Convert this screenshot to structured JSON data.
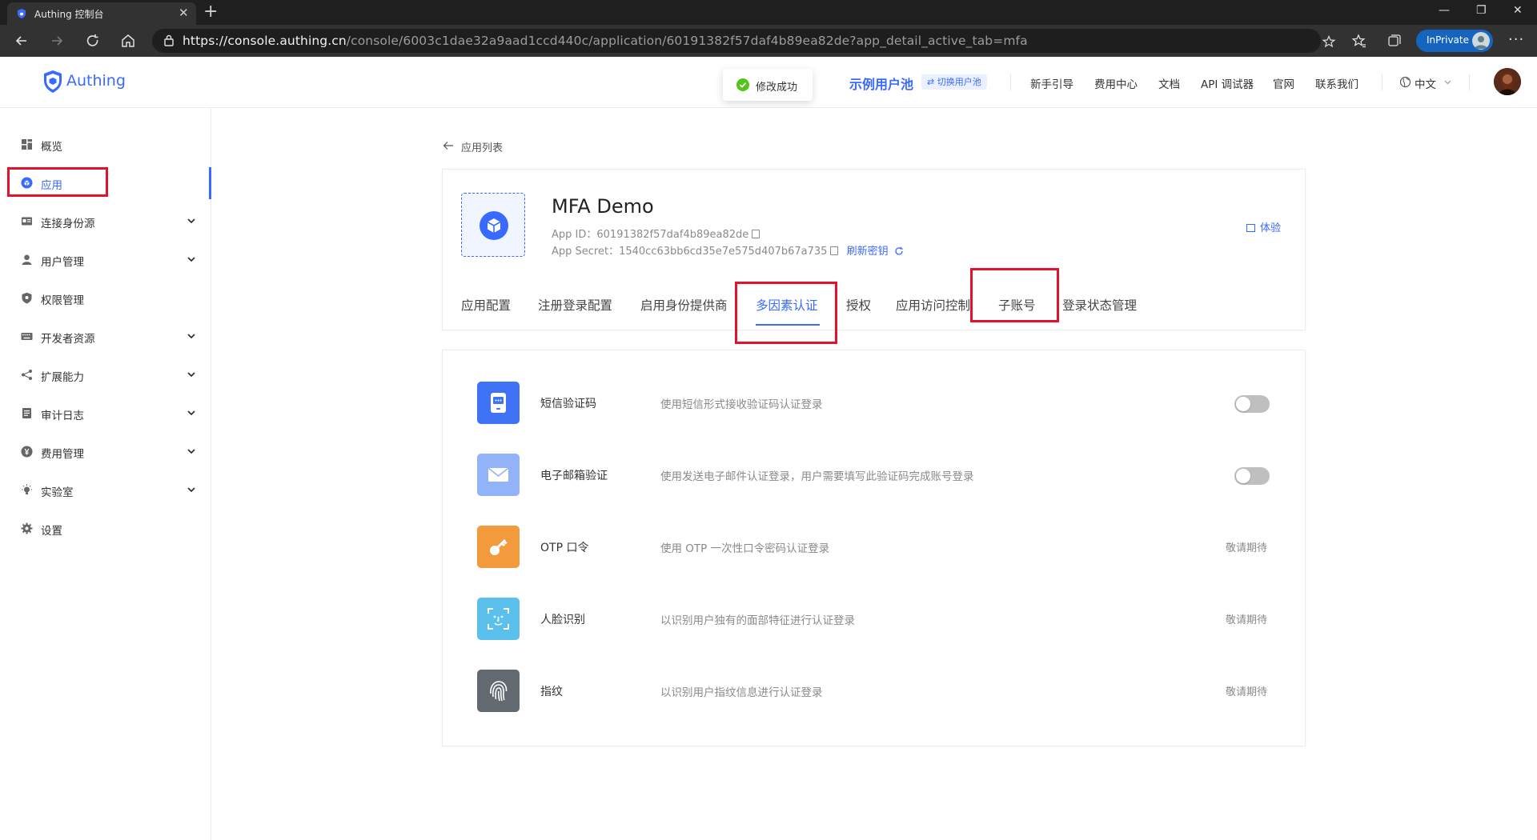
{
  "browser": {
    "tab_title": "Authing 控制台",
    "tab_close": "✕",
    "new_tab": "+",
    "window_controls": {
      "minimize": "—",
      "maximize": "❐",
      "close": "✕"
    },
    "url_host": "https://console.authing.cn",
    "url_path": "/console/6003c1dae32a9aad1ccd440c/application/60191382f57daf4b89ea82de?app_detail_active_tab=mfa",
    "inprivate_label": "InPrivate",
    "more": "···"
  },
  "header": {
    "logo_text": "Authing",
    "toast": "修改成功",
    "pool_name": "示例用户池",
    "pool_switch": "⇄ 切换用户池",
    "links": [
      "新手引导",
      "费用中心",
      "文档",
      "API 调试器",
      "官网",
      "联系我们"
    ],
    "language": "中文"
  },
  "sidebar": {
    "items": [
      {
        "label": "概览",
        "icon": "dashboard-icon",
        "expandable": false
      },
      {
        "label": "应用",
        "icon": "cube-icon",
        "expandable": false,
        "active": true
      },
      {
        "label": "连接身份源",
        "icon": "id-card-icon",
        "expandable": true
      },
      {
        "label": "用户管理",
        "icon": "user-icon",
        "expandable": true
      },
      {
        "label": "权限管理",
        "icon": "shield-icon",
        "expandable": false
      },
      {
        "label": "开发者资源",
        "icon": "keyboard-icon",
        "expandable": true
      },
      {
        "label": "扩展能力",
        "icon": "share-icon",
        "expandable": true
      },
      {
        "label": "审计日志",
        "icon": "file-icon",
        "expandable": true
      },
      {
        "label": "费用管理",
        "icon": "yen-icon",
        "expandable": true
      },
      {
        "label": "实验室",
        "icon": "bulb-icon",
        "expandable": true
      },
      {
        "label": "设置",
        "icon": "gear-icon",
        "expandable": false
      }
    ]
  },
  "main": {
    "back_label": "应用列表",
    "app": {
      "name": "MFA Demo",
      "app_id_label": "App ID：",
      "app_id": "60191382f57daf4b89ea82de",
      "secret_label": "App Secret：",
      "secret": "1540cc63bb6cd35e7e575d407b67a735",
      "refresh_label": "刷新密钥",
      "try_label": "体验"
    },
    "tabs": [
      "应用配置",
      "注册登录配置",
      "启用身份提供商",
      "多因素认证",
      "授权",
      "应用访问控制",
      "子账号",
      "登录状态管理"
    ],
    "active_tab": "多因素认证",
    "mfa": [
      {
        "name": "短信验证码",
        "desc": "使用短信形式接收验证码认证登录",
        "icon": "sms-icon",
        "color": "#3f72f5",
        "enabled": false,
        "status": null
      },
      {
        "name": "电子邮箱验证",
        "desc": "使用发送电子邮件认证登录，用户需要填写此验证码完成账号登录",
        "icon": "email-icon",
        "color": "#92b3f7",
        "enabled": false,
        "status": null
      },
      {
        "name": "OTP 口令",
        "desc": "使用 OTP 一次性口令密码认证登录",
        "icon": "key-icon",
        "color": "#f29a3c",
        "enabled": null,
        "status": "敬请期待"
      },
      {
        "name": "人脸识别",
        "desc": "以识别用户独有的面部特征进行认证登录",
        "icon": "face-icon",
        "color": "#5bc0eb",
        "enabled": null,
        "status": "敬请期待"
      },
      {
        "name": "指纹",
        "desc": "以识别用户指纹信息进行认证登录",
        "icon": "fingerprint-icon",
        "color": "#626971",
        "enabled": null,
        "status": "敬请期待"
      }
    ]
  },
  "colors": {
    "brand": "#396aff",
    "highlight": "#e3122c",
    "toggle_off": "#bfbfbf",
    "success": "#52c41a"
  }
}
